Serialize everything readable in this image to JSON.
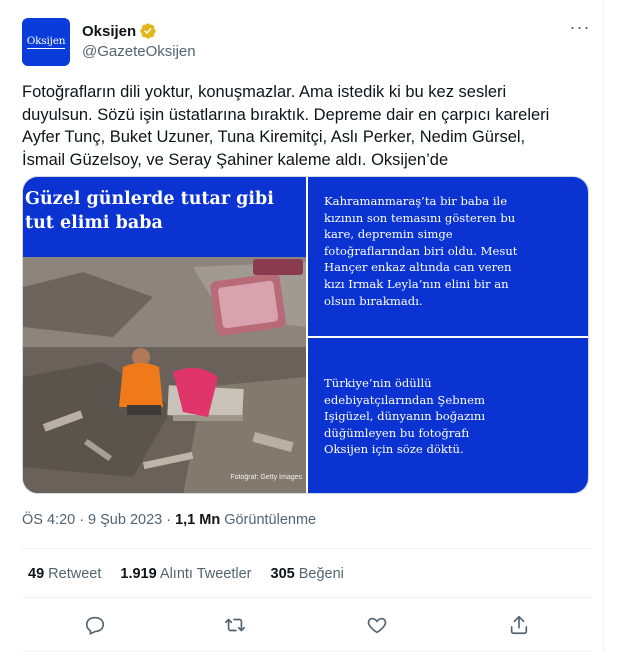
{
  "account": {
    "avatar_text": "Oksijen",
    "display_name": "Oksijen",
    "handle": "@GazeteOksijen",
    "verified_color": "#f4b400"
  },
  "tweet": {
    "text": "Fotoğrafların dili yoktur, konuşmazlar. Ama istedik ki bu kez sesleri\nduyulsun. Sözü işin üstatlarına bıraktık. Depreme dair en çarpıcı kareleri\nAyfer Tunç, Buket Uzuner, Tuna Kiremitçi, Aslı Perker, Nedim Gürsel,\nİsmail Güzelsoy, ve Seray Şahiner kaleme aldı. Oksijen’de"
  },
  "media": {
    "photo_title": "Güzel günlerde tutar gibi\ntut elimi baba",
    "photo_credit": "Fotoğraf: Getty Images",
    "panel_top_text": "Kahramanmaraş’ta bir baba ile\nkızının son temasını gösteren bu\nkare, depremin simge\nfotoğraflarından biri oldu. Mesut\nHançer enkaz altında can veren\nkızı Irmak Leyla’nın elini bir an\nolsun bırakmadı.",
    "panel_bottom_text": "Türkiye’nin ödüllü\nedebiyatçılarından Şebnem\nIşigüzel, dünyanın boğazını\ndüğümleyen bu fotoğrafı\nOksijen için söze döktü.",
    "panel_color": "#0a33d2"
  },
  "meta": {
    "time": "ÖS 4:20",
    "separator": "·",
    "date": "9 Şub 2023",
    "separator2": "·",
    "views_count": "1,1 Mn",
    "views_label": "Görüntülenme"
  },
  "stats": {
    "retweets_count": "49",
    "retweets_label": "Retweet",
    "quotes_count": "1.919",
    "quotes_label": "Alıntı Tweetler",
    "likes_count": "305",
    "likes_label": "Beğeni"
  },
  "actions": [
    "reply-icon",
    "retweet-icon",
    "like-icon",
    "share-icon"
  ],
  "colors": {
    "text": "#0f1419",
    "secondary": "#536471",
    "divider": "#eff3f4"
  }
}
